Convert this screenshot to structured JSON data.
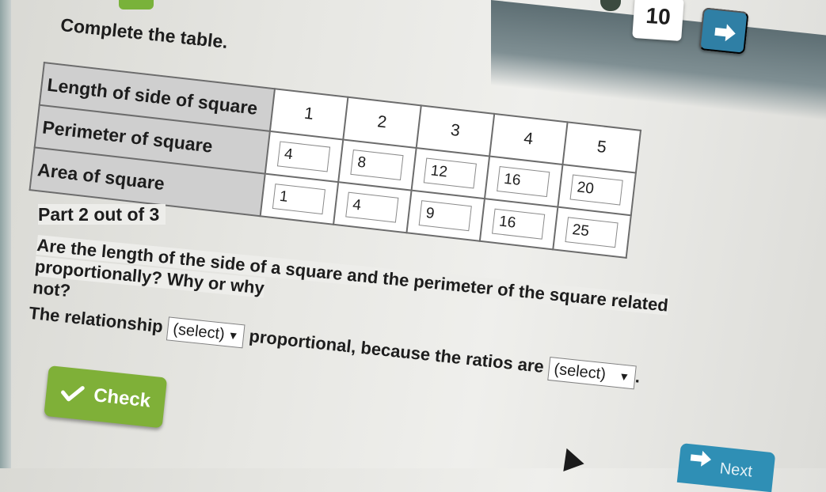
{
  "header": {
    "page_number": "10"
  },
  "instruction": "Complete the table.",
  "table": {
    "rows": [
      {
        "label": "Length of side of square",
        "cells": [
          "1",
          "2",
          "3",
          "4",
          "5"
        ]
      },
      {
        "label": "Perimeter of square",
        "cells": [
          "4",
          "8",
          "12",
          "16",
          "20"
        ]
      },
      {
        "label": "Area of square",
        "cells": [
          "1",
          "4",
          "9",
          "16",
          "25"
        ]
      }
    ]
  },
  "part_label": "Part 2 out of 3",
  "question": {
    "line1_start": "Are the length of the side of a square and the perimeter of the square related proportionally? Why or why",
    "line1_visible_tail": "the length of the side of a square and the perimeter of the square related proportionally? Why or why",
    "line2": "not?"
  },
  "answer": {
    "prefix": "The relationship",
    "select1_value": "(select)",
    "middle": "proportional, because the ratios are",
    "select2_value": "(select)",
    "suffix": "."
  },
  "check_button_label": "Check",
  "next_button_label": "Next",
  "colors": {
    "check_green": "#7fb038",
    "nav_blue": "#2f7fa5",
    "header_gray": "#cfcfcf"
  },
  "icons": {
    "check": "check-icon",
    "arrow": "arrow-right-icon",
    "chevron": "chevron-down-icon"
  }
}
